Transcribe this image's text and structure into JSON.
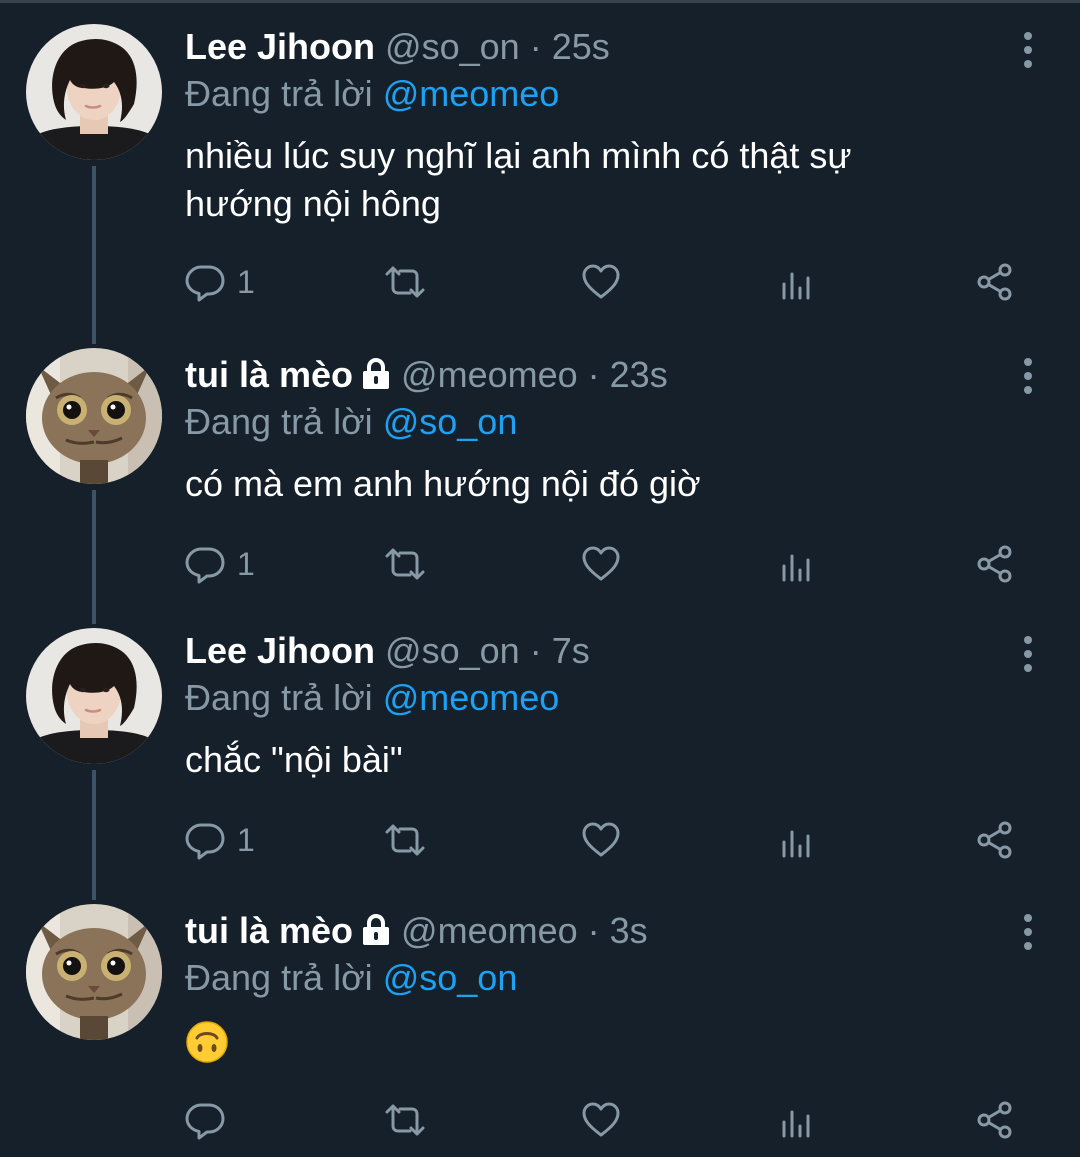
{
  "colors": {
    "background": "#15202b",
    "text_primary": "#ffffff",
    "text_secondary": "#8899a6",
    "accent": "#1da1f2",
    "thread_line": "#3d5466"
  },
  "reply_prefix": "Đang trả lời",
  "tweets": [
    {
      "name": "Lee Jihoon",
      "handle": "@so_on",
      "time": "· 25s",
      "reply_to": "@meomeo",
      "text_line1": "nhiều lúc suy nghĩ lại anh mình có thật sự",
      "text_line2": "hướng nội hông",
      "reply_count": "1",
      "avatar": "person-avatar",
      "locked": false
    },
    {
      "name": "tui là mèo",
      "handle": "@meomeo",
      "time": "· 23s",
      "reply_to": "@so_on",
      "text_line1": "có mà em anh hướng nội đó giờ",
      "text_line2": "",
      "reply_count": "1",
      "avatar": "cat-avatar",
      "locked": true
    },
    {
      "name": "Lee Jihoon",
      "handle": "@so_on",
      "time": "· 7s",
      "reply_to": "@meomeo",
      "text_line1": "chắc \"nội bài\"",
      "text_line2": "",
      "reply_count": "1",
      "avatar": "person-avatar",
      "locked": false
    },
    {
      "name": "tui là mèo",
      "handle": "@meomeo",
      "time": "· 3s",
      "reply_to": "@so_on",
      "text_line1": "",
      "text_line2": "",
      "emoji": "upside-down-face",
      "reply_count": "",
      "avatar": "cat-avatar",
      "locked": true
    }
  ],
  "icons": [
    "reply-icon",
    "retweet-icon",
    "like-icon",
    "analytics-icon",
    "share-icon",
    "more-icon",
    "lock-icon"
  ]
}
